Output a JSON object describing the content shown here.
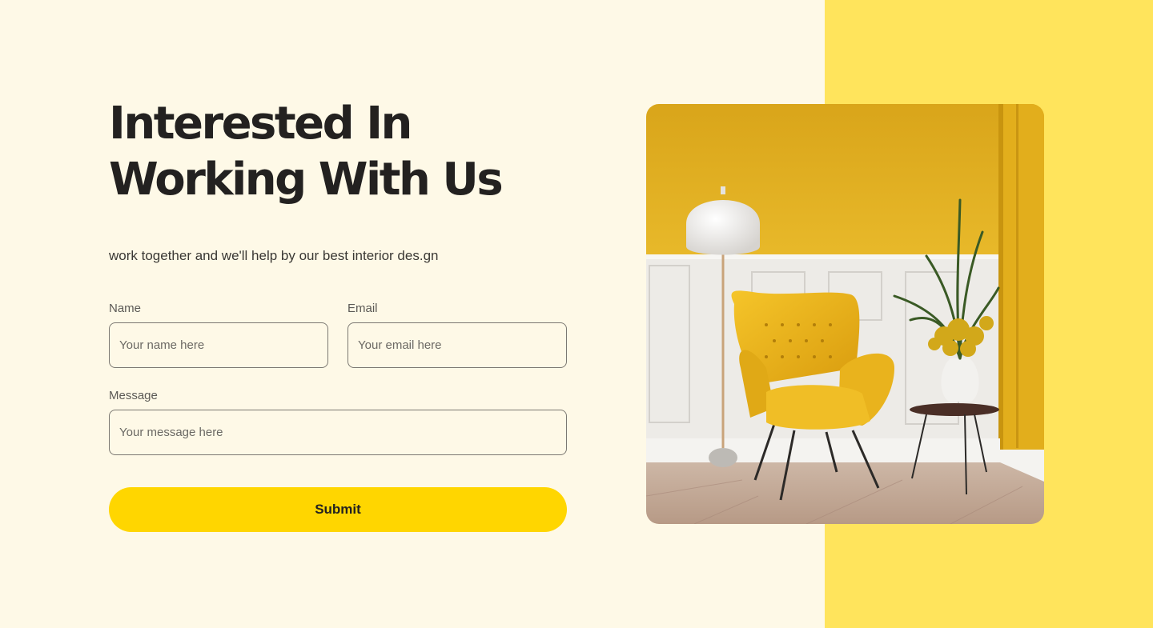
{
  "hero": {
    "title_line1": "Interested In",
    "title_line2": "Working With Us",
    "subtitle": "work together and we'll help by our best interior des.gn"
  },
  "form": {
    "name": {
      "label": "Name",
      "placeholder": "Your name here"
    },
    "email": {
      "label": "Email",
      "placeholder": "Your email here"
    },
    "message": {
      "label": "Message",
      "placeholder": "Your message here"
    },
    "submit_label": "Submit"
  },
  "colors": {
    "page_background": "#FEF9E7",
    "accent_panel": "#FFE45C",
    "button": "#FFD600",
    "text": "#232120"
  },
  "image": {
    "subject": "yellow armchair with floor lamp and potted plant"
  }
}
